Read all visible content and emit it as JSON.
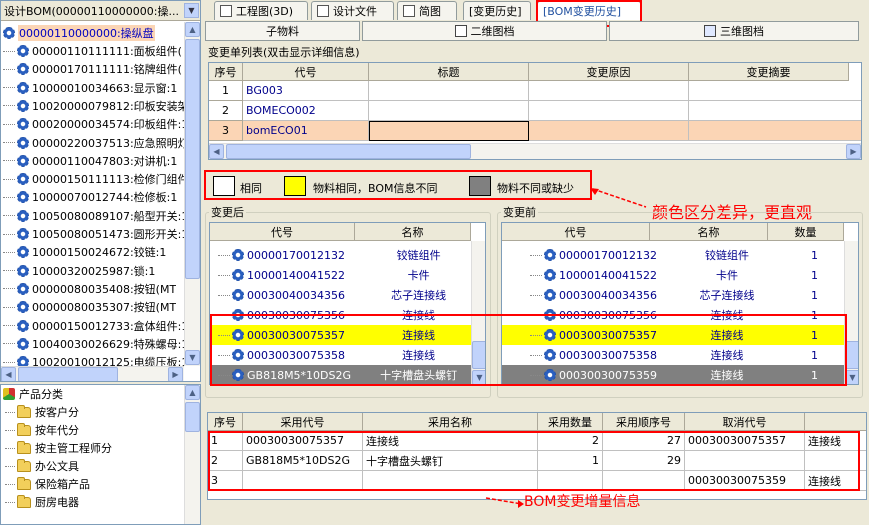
{
  "left_panel": {
    "title": "设计BOM(00000110000000:操...",
    "root": "00000110000000:操纵盘",
    "tree_items": [
      "00000110111111:面板组件(",
      "00000170111111:铭牌组件(",
      "10000010034663:显示窗:1",
      "10020000079812:印板安装架",
      "00020000034574:印板组件:1",
      "00000220037513:应急照明灯",
      "00000110047803:对讲机:1",
      "00000150111113:检修门组件",
      "10000070012744:检修板:1",
      "10050080089107:船型开关:1",
      "10050080051473:圆形开关:1",
      "10000150024672:铰链:1",
      "10000320025987:锁:1",
      "00000080035408:按钮(MT",
      "00000080035307:按钮(MT",
      "00000150012733:盒体组件:1",
      "10040030026629:特殊螺母:1",
      "10020010012125:电缆压板:1"
    ]
  },
  "category_panel": {
    "title": "产品分类",
    "items": [
      "按客户分",
      "按年代分",
      "按主管工程师分",
      "办公文具",
      "保险箱产品",
      "厨房电器"
    ]
  },
  "tabs": [
    {
      "label": "工程图(3D)"
    },
    {
      "label": "设计文件"
    },
    {
      "label": "简图"
    },
    {
      "label": "[变更历史]"
    },
    {
      "label": "[BOM变更历史]"
    }
  ],
  "subtabs": [
    "子物料",
    "二维图档",
    "三维图档"
  ],
  "change_list": {
    "label": "变更单列表(双击显示详细信息)",
    "headers": [
      "序号",
      "代号",
      "标题",
      "变更原因",
      "变更摘要"
    ],
    "rows": [
      {
        "no": "1",
        "code": "BG003"
      },
      {
        "no": "2",
        "code": "BOMECO002"
      },
      {
        "no": "3",
        "code": "bomECO01"
      }
    ]
  },
  "legend": {
    "same": "相同",
    "material_same": "物料相同，BOM信息不同",
    "material_diff": "物料不同或缺少",
    "colors": {
      "same": "#ffffff",
      "material_same": "#ffff00",
      "material_diff": "#808080"
    }
  },
  "annotation_color": "颜色区分差异，更直观",
  "annotation_increment": "BOM变更增量信息",
  "after": {
    "label": "变更后",
    "headers": [
      "代号",
      "名称"
    ],
    "rows": [
      {
        "code": "00000170012132",
        "name": "铰链组件",
        "state": "same"
      },
      {
        "code": "10000140041522",
        "name": "卡件",
        "state": "same"
      },
      {
        "code": "00030040034356",
        "name": "芯子连接线",
        "state": "same"
      },
      {
        "code": "00030030075356",
        "name": "连接线",
        "state": "same"
      },
      {
        "code": "00030030075357",
        "name": "连接线",
        "state": "yellow"
      },
      {
        "code": "00030030075358",
        "name": "连接线",
        "state": "same"
      },
      {
        "code": "GB818M5*10DS2G",
        "name": "十字槽盘头螺钉",
        "state": "gray"
      }
    ]
  },
  "before": {
    "label": "变更前",
    "headers": [
      "代号",
      "名称",
      "数量"
    ],
    "rows": [
      {
        "code": "00000170012132",
        "name": "铰链组件",
        "qty": "1",
        "state": "same"
      },
      {
        "code": "10000140041522",
        "name": "卡件",
        "qty": "1",
        "state": "same"
      },
      {
        "code": "00030040034356",
        "name": "芯子连接线",
        "qty": "1",
        "state": "same"
      },
      {
        "code": "00030030075356",
        "name": "连接线",
        "qty": "1",
        "state": "same"
      },
      {
        "code": "00030030075357",
        "name": "连接线",
        "qty": "1",
        "state": "yellow"
      },
      {
        "code": "00030030075358",
        "name": "连接线",
        "qty": "1",
        "state": "same"
      },
      {
        "code": "00030030075359",
        "name": "连接线",
        "qty": "1",
        "state": "gray"
      }
    ]
  },
  "increment": {
    "headers": [
      "序号",
      "采用代号",
      "采用名称",
      "采用数量",
      "采用顺序号",
      "取消代号",
      ""
    ],
    "rows": [
      {
        "no": "1",
        "code": "00030030075357",
        "name": "连接线",
        "qty": "2",
        "seq": "27",
        "cancel_code": "00030030075357",
        "cancel_name": "连接线"
      },
      {
        "no": "2",
        "code": "GB818M5*10DS2G",
        "name": "十字槽盘头螺钉",
        "qty": "1",
        "seq": "29",
        "cancel_code": "",
        "cancel_name": ""
      },
      {
        "no": "3",
        "code": "",
        "name": "",
        "qty": "",
        "seq": "",
        "cancel_code": "00030030075359",
        "cancel_name": "连接线"
      }
    ]
  }
}
